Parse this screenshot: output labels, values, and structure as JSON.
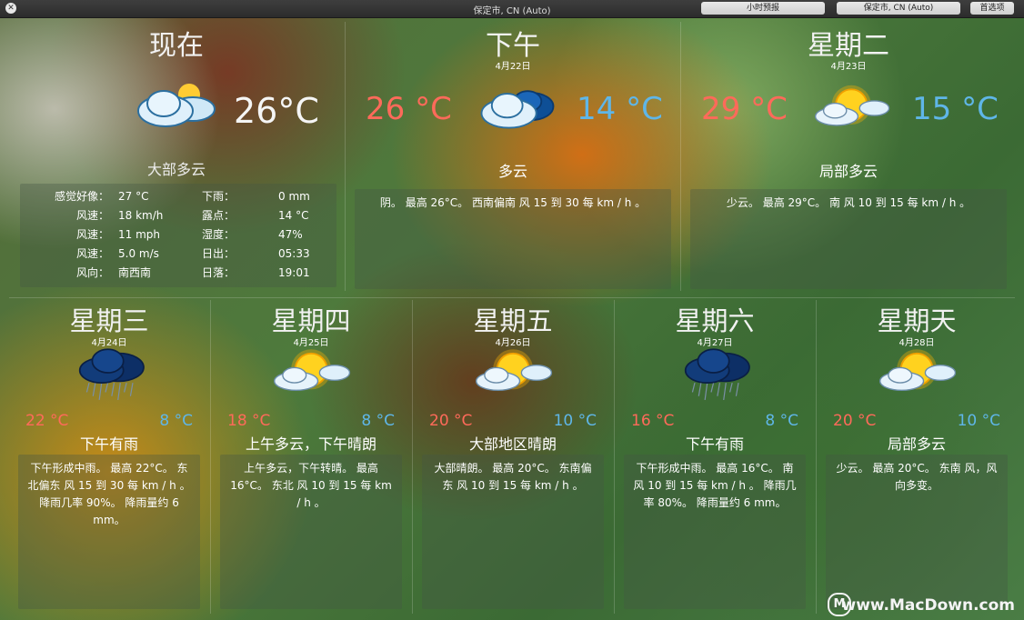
{
  "titlebar": {
    "title": "保定市, CN (Auto)",
    "buttons": [
      "小时预报",
      "保定市, CN (Auto)",
      "首选项"
    ]
  },
  "now": {
    "title": "现在",
    "temp": "26°C",
    "icon": "partly-cloudy-icon",
    "condition": "大部多云",
    "details_left": [
      {
        "label": "感觉好像：",
        "value": "27 °C"
      },
      {
        "label": "风速：",
        "value": "18 km/h"
      },
      {
        "label": "风速：",
        "value": "11 mph"
      },
      {
        "label": "风速：",
        "value": "5.0 m/s"
      },
      {
        "label": "风向：",
        "value": "南西南"
      }
    ],
    "details_right": [
      {
        "label": "下雨：",
        "value": "0 mm"
      },
      {
        "label": "露点：",
        "value": "14 °C"
      },
      {
        "label": "湿度：",
        "value": "47%"
      },
      {
        "label": "日出：",
        "value": "05:33"
      },
      {
        "label": "日落：",
        "value": "19:01"
      }
    ]
  },
  "top_days": [
    {
      "title": "下午",
      "date": "4月22日",
      "hi": "26 °C",
      "lo": "14 °C",
      "icon": "cloudy-icon",
      "condition": "多云",
      "description": "阴。 最高 26°C。 西南偏南 风 15 到 30 每 km / h 。"
    },
    {
      "title": "星期二",
      "date": "4月23日",
      "hi": "29 °C",
      "lo": "15 °C",
      "icon": "sun-cloud-icon",
      "condition": "局部多云",
      "description": "少云。 最高 29°C。 南 风 10 到 15 每 km / h 。"
    }
  ],
  "bottom_days": [
    {
      "title": "星期三",
      "date": "4月24日",
      "hi": "22 °C",
      "lo": "8 °C",
      "icon": "rain-cloud-icon",
      "condition": "下午有雨",
      "description": "下午形成中雨。 最高 22°C。 东北偏东 风 15 到 30 每 km / h 。 降雨几率 90%。 降雨量约 6 mm。"
    },
    {
      "title": "星期四",
      "date": "4月25日",
      "hi": "18 °C",
      "lo": "8 °C",
      "icon": "sun-cloud-icon",
      "condition": "上午多云，下午晴朗",
      "description": "上午多云，下午转晴。 最高 16°C。 东北 风 10 到 15 每 km / h 。"
    },
    {
      "title": "星期五",
      "date": "4月26日",
      "hi": "20 °C",
      "lo": "10 °C",
      "icon": "sun-cloud-icon",
      "condition": "大部地区晴朗",
      "description": "大部晴朗。 最高 20°C。 东南偏东 风 10 到 15 每 km / h 。"
    },
    {
      "title": "星期六",
      "date": "4月27日",
      "hi": "16 °C",
      "lo": "8 °C",
      "icon": "rain-cloud-icon",
      "condition": "下午有雨",
      "description": "下午形成中雨。 最高 16°C。 南 风 10 到 15 每 km / h 。 降雨几率 80%。 降雨量约 6 mm。"
    },
    {
      "title": "星期天",
      "date": "4月28日",
      "hi": "20 °C",
      "lo": "10 °C",
      "icon": "sun-cloud-icon",
      "condition": "局部多云",
      "description": "少云。 最高 20°C。 东南 风，风向多变。"
    }
  ],
  "watermark": {
    "text": "www.MacDown.com",
    "logo": "M"
  },
  "colors": {
    "hi": "#ff6a5a",
    "lo": "#5fb6e8"
  }
}
